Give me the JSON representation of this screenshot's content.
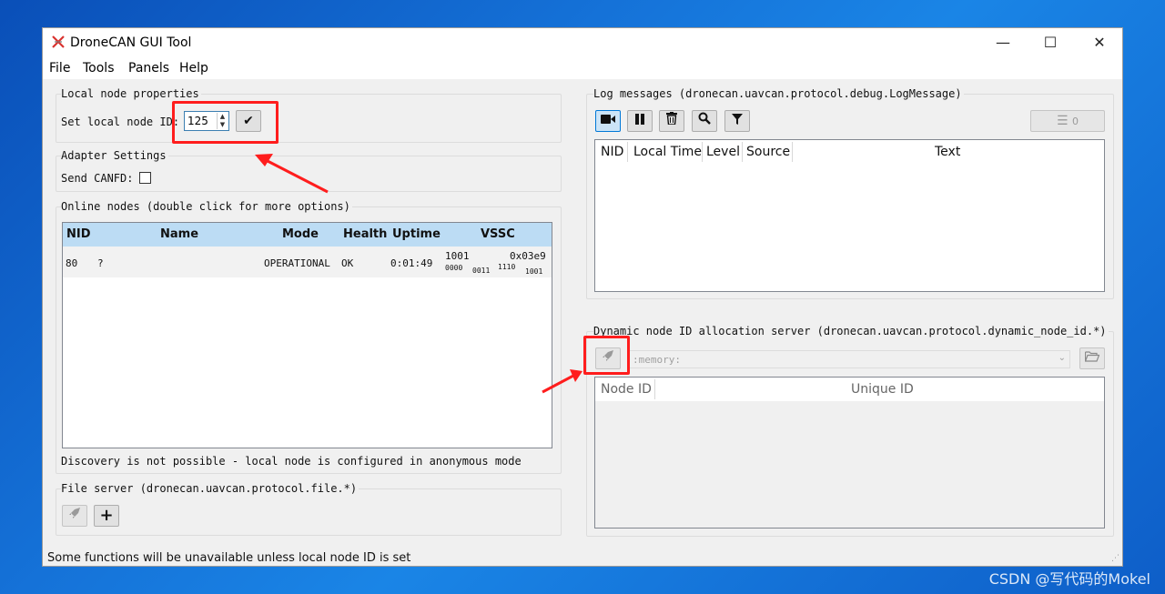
{
  "window": {
    "title": "DroneCAN GUI Tool",
    "controls": {
      "minimize": "—",
      "maximize": "☐",
      "close": "✕"
    }
  },
  "menu": [
    "File",
    "Tools",
    "Panels",
    "Help"
  ],
  "local_node": {
    "group_title": "Local node properties",
    "set_label": "Set local node ID:",
    "node_id_value": "125"
  },
  "adapter": {
    "group_title": "Adapter Settings",
    "canfd_label": "Send CANFD:"
  },
  "online_nodes": {
    "group_title": "Online nodes (double click for more options)",
    "columns": [
      "NID",
      "Name",
      "Mode",
      "Health",
      "Uptime",
      "VSSC"
    ],
    "rows": [
      {
        "nid": "80",
        "name": "?",
        "mode": "OPERATIONAL",
        "health": "OK",
        "uptime": "0:01:49",
        "vssc_dec": "1001",
        "vssc_hex": "0x03e9",
        "vssc_bits": [
          "0000",
          "0011",
          "1110",
          "1001"
        ]
      }
    ],
    "discovery_note": "Discovery is not possible - local node is configured in anonymous mode"
  },
  "file_server": {
    "group_title": "File server (dronecan.uavcan.protocol.file.*)"
  },
  "log_messages": {
    "group_title": "Log messages (dronecan.uavcan.protocol.debug.LogMessage)",
    "columns": [
      "NID",
      "Local Time",
      "Level",
      "Source",
      "Text"
    ],
    "count": "0"
  },
  "dynamic_alloc": {
    "group_title": "Dynamic node ID allocation server (dronecan.uavcan.protocol.dynamic_node_id.*)",
    "db_path": ":memory:",
    "columns": [
      "Node ID",
      "Unique ID"
    ]
  },
  "status_text": "Some functions will be unavailable unless local node ID is set",
  "watermark": "CSDN @写代码的Mokel",
  "colors": {
    "annotation_red": "#ff1d1d",
    "table_header_blue": "#bcdcf4",
    "desktop_blue": "#1572d8"
  },
  "icons": {
    "record": "video-camera-icon",
    "pause": "pause-icon",
    "clear": "trash-icon",
    "search": "search-icon",
    "filter": "filter-icon",
    "list": "list-icon",
    "rocket": "rocket-icon",
    "folder": "folder-open-icon",
    "check": "checkmark-icon",
    "plus": "plus-icon"
  }
}
